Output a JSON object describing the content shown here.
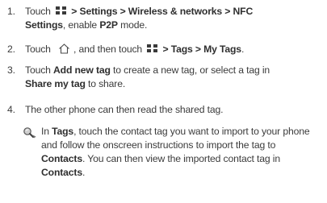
{
  "steps": [
    {
      "num": "1.",
      "l1_a": "Touch",
      "l1_b": "> Settings > Wireless & networks > NFC",
      "l2_a": "Settings",
      "l2_b": ", enable ",
      "l2_c": "P2P",
      "l2_d": " mode."
    },
    {
      "num": "2.",
      "l1_a": "Touch",
      "l1_b": ", and then touch",
      "l1_c": "> Tags > My Tags",
      "l1_d": "."
    },
    {
      "num": "3.",
      "l1_a": "Touch ",
      "l1_b": "Add new tag",
      "l1_c": " to create a new tag, or select a tag in",
      "l2_a": "Share my tag",
      "l2_b": " to share."
    },
    {
      "num": "4.",
      "l1_a": "The other phone can then read the shared tag."
    }
  ],
  "note": {
    "icon": "tip-icon",
    "l1_a": "In ",
    "l1_b": "Tags",
    "l1_c": ", touch the contact tag you want to import to your phone",
    "l2": "and follow the onscreen instructions to import the tag to",
    "l3_a": "Contacts",
    "l3_b": ". You can then view the imported contact tag in",
    "l4_a": "Contacts",
    "l4_b": "."
  },
  "icons": {
    "apps": "apps-grid-icon",
    "home": "home-icon"
  },
  "colors": {
    "text": "#3b3b3b",
    "icon": "#3a3a3a"
  }
}
